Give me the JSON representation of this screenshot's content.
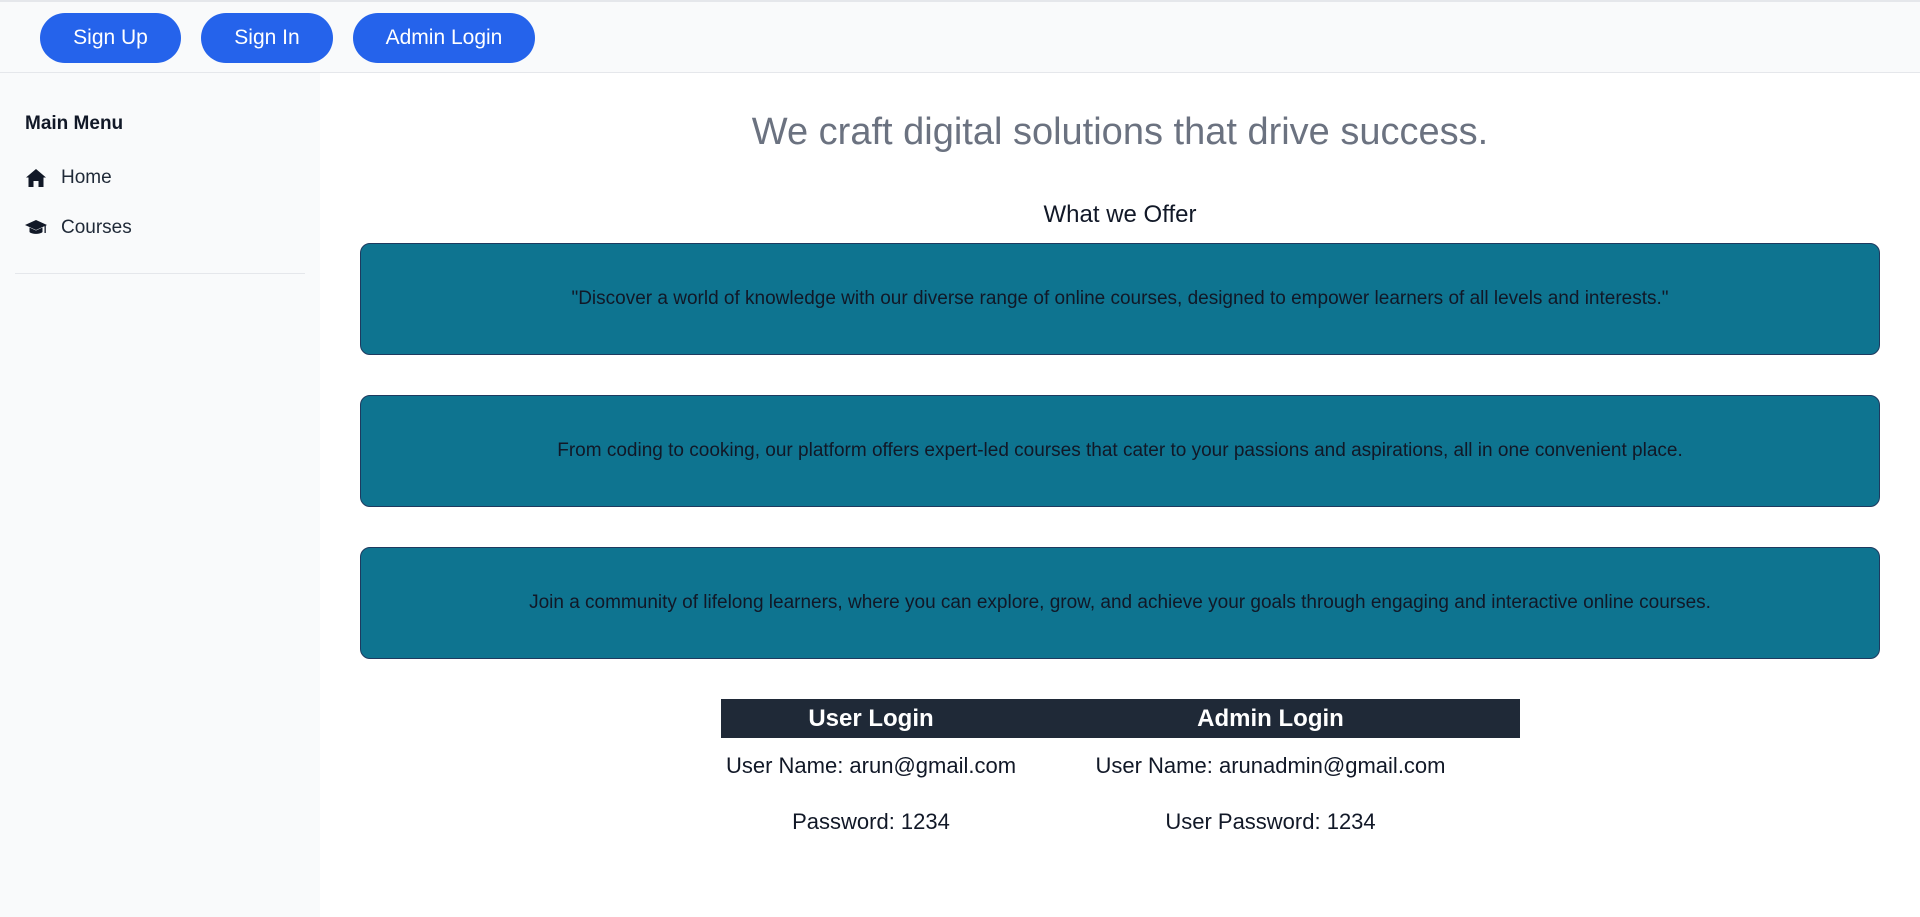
{
  "header": {
    "buttons": {
      "sign_up": "Sign Up",
      "sign_in": "Sign In",
      "admin_login": "Admin Login"
    }
  },
  "sidebar": {
    "title": "Main Menu",
    "items": [
      {
        "label": "Home",
        "icon": "home-icon"
      },
      {
        "label": "Courses",
        "icon": "graduation-cap-icon"
      }
    ]
  },
  "main": {
    "headline": "We craft digital solutions that drive success.",
    "subheadline": "What we Offer",
    "cards": [
      "\"Discover a world of knowledge with our diverse range of online courses, designed to empower learners of all levels and interests.\"",
      "From coding to cooking, our platform offers expert-led courses that cater to your passions and aspirations, all in one convenient place.",
      "Join a community of lifelong learners, where you can explore, grow, and achieve your goals through engaging and interactive online courses."
    ],
    "login_table": {
      "headers": [
        "User Login",
        "Admin Login"
      ],
      "rows": [
        [
          "User Name: arun@gmail.com",
          "User Name: arunadmin@gmail.com"
        ],
        [
          "Password: 1234",
          "User Password: 1234"
        ]
      ]
    }
  },
  "colors": {
    "primary_button": "#2563eb",
    "card_background": "#0e7490",
    "table_header": "#1f2937",
    "sidebar_background": "#f9fafb"
  }
}
